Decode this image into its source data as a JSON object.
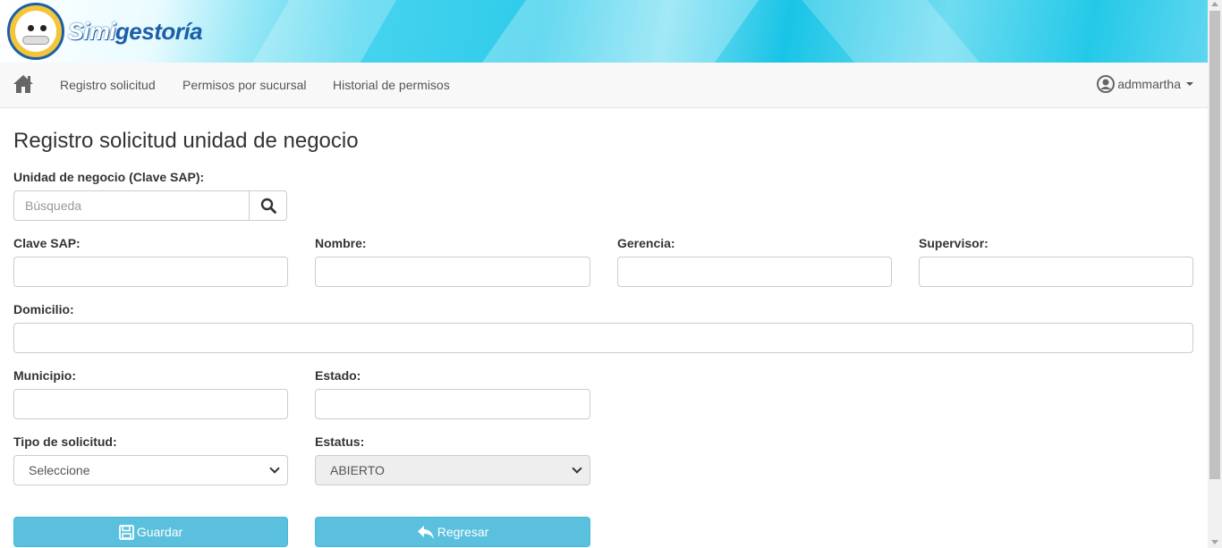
{
  "brand": {
    "name_part1": "Simi",
    "name_part2": "gestoría"
  },
  "nav": {
    "links": [
      "Registro solicitud",
      "Permisos por sucursal",
      "Historial de permisos"
    ],
    "user": "admmartha"
  },
  "page": {
    "title": "Registro solicitud unidad de negocio"
  },
  "form": {
    "unidad_label": "Unidad de negocio (Clave SAP):",
    "search_placeholder": "Búsqueda",
    "clave_sap_label": "Clave SAP:",
    "nombre_label": "Nombre:",
    "gerencia_label": "Gerencia:",
    "supervisor_label": "Supervisor:",
    "domicilio_label": "Domicilio:",
    "municipio_label": "Municipio:",
    "estado_label": "Estado:",
    "tipo_label": "Tipo de solicitud:",
    "tipo_value": "Seleccione",
    "estatus_label": "Estatus:",
    "estatus_value": "ABIERTO",
    "save_label": "Guardar",
    "back_label": "Regresar"
  },
  "colors": {
    "accent_button": "#5bc0de",
    "navbar_bg": "#f8f8f8",
    "banner": "#2ecbea"
  },
  "icons": {
    "home": "home-icon",
    "search": "search-icon",
    "user": "user-circle-icon",
    "save": "floppy-disk-icon",
    "back": "reply-arrow-icon"
  }
}
